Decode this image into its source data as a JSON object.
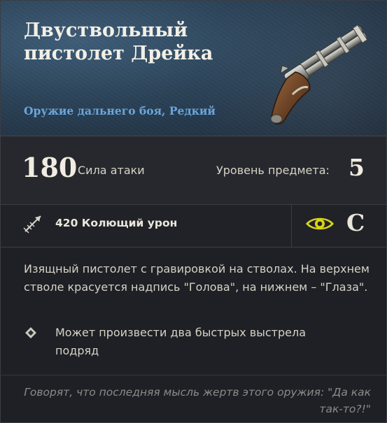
{
  "item": {
    "name": "Двуствольный пистолет Дрейка",
    "category": "Оружие дальнего боя, Редкий",
    "weapon_icon": "double-barrel-flintlock-pistol",
    "accent_color": "#6aa6dc"
  },
  "stats": {
    "attack_value": "180",
    "attack_label": "Сила атаки",
    "level_label": "Уровень предмета:",
    "level_value": "5"
  },
  "damage": {
    "icon": "piercing-damage-icon",
    "text": "420 Колющий урон",
    "scaling_icon": "eye-icon",
    "scaling_color": "#d8d21a",
    "grade": "C"
  },
  "description": "Изящный пистолет с гравировкой на стволах. На верхнем стволе красуется надпись \"Голова\", на нижнем – \"Глаза\".",
  "perk": {
    "icon": "diamond-bullet-icon",
    "text": "Может произвести два быстрых выстрела подряд"
  },
  "flavor_text": "Говорят, что последняя мысль жертв этого оружия: \"Да как так-то?!\""
}
